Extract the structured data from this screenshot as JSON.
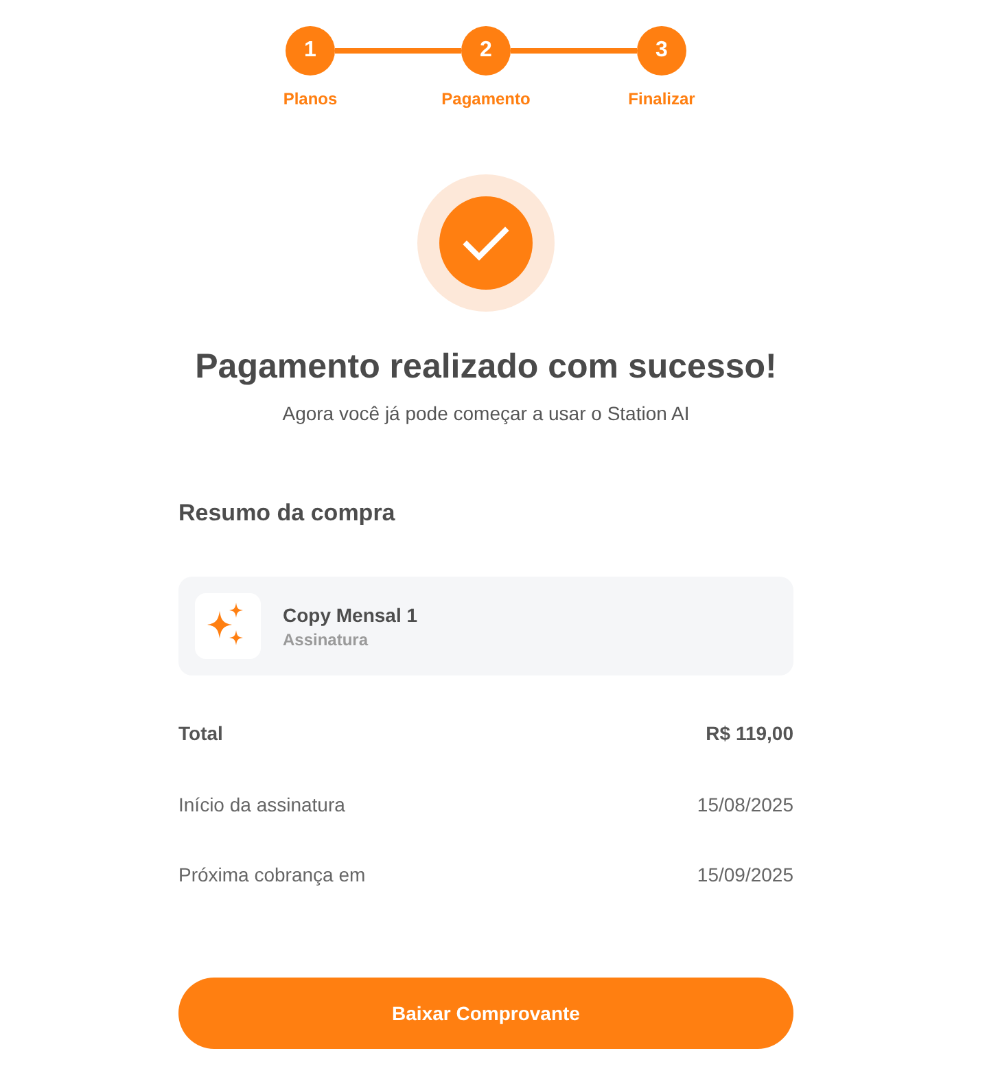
{
  "stepper": {
    "steps": [
      {
        "number": "1",
        "label": "Planos",
        "done": true
      },
      {
        "number": "2",
        "label": "Pagamento",
        "done": true
      },
      {
        "number": "3",
        "label": "Finalizar",
        "done": true
      }
    ]
  },
  "success": {
    "title": "Pagamento realizado com sucesso!",
    "subtitle": "Agora você já pode começar a usar o Station AI"
  },
  "summary": {
    "heading": "Resumo da compra",
    "item": {
      "name": "Copy Mensal 1",
      "type": "Assinatura"
    },
    "rows": [
      {
        "kind": "total",
        "label": "Total",
        "value": "R$ 119,00"
      },
      {
        "kind": "detail",
        "label": "Início da assinatura",
        "value": "15/08/2025"
      },
      {
        "kind": "detail",
        "label": "Próxima cobrança em",
        "value": "15/09/2025"
      }
    ]
  },
  "button": {
    "label": "Baixar Comprovante"
  }
}
